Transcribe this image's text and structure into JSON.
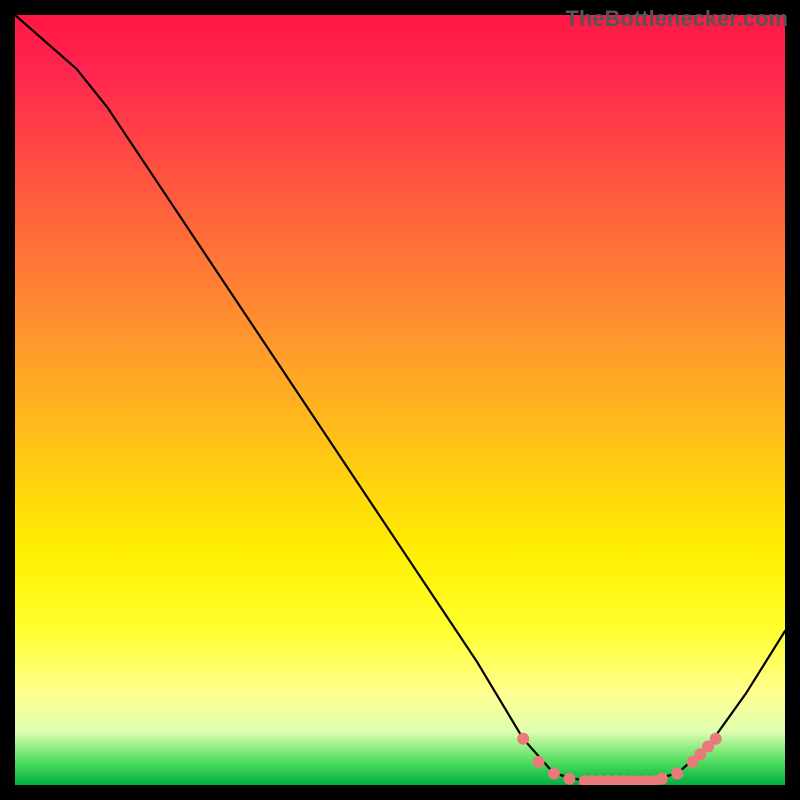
{
  "watermark": "TheBottlenecker.com",
  "chart_data": {
    "type": "line",
    "title": "",
    "xlabel": "",
    "ylabel": "",
    "xlim": [
      0,
      100
    ],
    "ylim": [
      0,
      100
    ],
    "curve": {
      "points": [
        {
          "x": 0,
          "y": 100
        },
        {
          "x": 8,
          "y": 93
        },
        {
          "x": 12,
          "y": 88
        },
        {
          "x": 20,
          "y": 76
        },
        {
          "x": 30,
          "y": 61
        },
        {
          "x": 40,
          "y": 46
        },
        {
          "x": 50,
          "y": 31
        },
        {
          "x": 60,
          "y": 16
        },
        {
          "x": 66,
          "y": 6
        },
        {
          "x": 70,
          "y": 1.5
        },
        {
          "x": 74,
          "y": 0.5
        },
        {
          "x": 78,
          "y": 0.5
        },
        {
          "x": 82,
          "y": 0.5
        },
        {
          "x": 86,
          "y": 1.5
        },
        {
          "x": 90,
          "y": 5
        },
        {
          "x": 95,
          "y": 12
        },
        {
          "x": 100,
          "y": 20
        }
      ]
    },
    "markers": [
      {
        "x": 66,
        "y": 6
      },
      {
        "x": 68,
        "y": 3
      },
      {
        "x": 70,
        "y": 1.5
      },
      {
        "x": 72,
        "y": 0.8
      },
      {
        "x": 74,
        "y": 0.5
      },
      {
        "x": 75,
        "y": 0.5
      },
      {
        "x": 76,
        "y": 0.5
      },
      {
        "x": 77,
        "y": 0.5
      },
      {
        "x": 78,
        "y": 0.5
      },
      {
        "x": 79,
        "y": 0.5
      },
      {
        "x": 80,
        "y": 0.5
      },
      {
        "x": 81,
        "y": 0.5
      },
      {
        "x": 82,
        "y": 0.5
      },
      {
        "x": 83,
        "y": 0.5
      },
      {
        "x": 84,
        "y": 0.8
      },
      {
        "x": 86,
        "y": 1.5
      },
      {
        "x": 88,
        "y": 3
      },
      {
        "x": 89,
        "y": 4
      },
      {
        "x": 90,
        "y": 5
      },
      {
        "x": 91,
        "y": 6
      }
    ],
    "marker_color": "#e87a7a",
    "gradient_stops": [
      {
        "pos": 0,
        "color": "#ff1744"
      },
      {
        "pos": 50,
        "color": "#ffd010"
      },
      {
        "pos": 85,
        "color": "#ffff60"
      },
      {
        "pos": 100,
        "color": "#00b040"
      }
    ]
  }
}
